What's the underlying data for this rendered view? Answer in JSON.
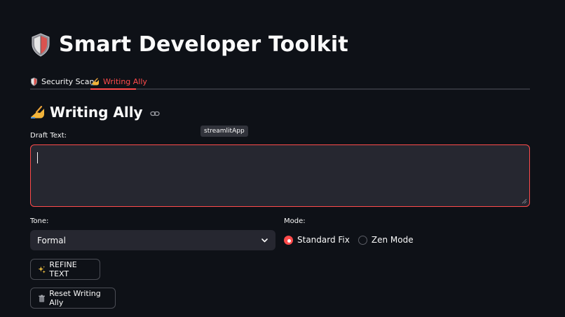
{
  "app": {
    "title": "Smart Developer Toolkit",
    "title_icon": "shield-icon"
  },
  "tabs": [
    {
      "label": "Security Scan",
      "icon": "shield-icon",
      "active": false
    },
    {
      "label": "Writing Ally",
      "icon": "writing-hand-icon",
      "active": true
    }
  ],
  "section": {
    "heading": "Writing Ally",
    "heading_icon": "writing-hand-icon",
    "anchor_icon": "link-icon"
  },
  "tooltip": "streamlitApp",
  "draft": {
    "label": "Draft Text:",
    "value": ""
  },
  "tone": {
    "label": "Tone:",
    "selected": "Formal"
  },
  "mode": {
    "label": "Mode:",
    "options": [
      {
        "label": "Standard Fix",
        "checked": true
      },
      {
        "label": "Zen Mode",
        "checked": false
      }
    ]
  },
  "buttons": {
    "refine": {
      "label": "REFINE TEXT",
      "icon": "sparkles-icon"
    },
    "reset": {
      "label": "Reset Writing Ally",
      "icon": "trash-icon"
    }
  },
  "colors": {
    "background": "#0e1117",
    "accent": "#ff4b4b",
    "input_bg": "#262730"
  }
}
